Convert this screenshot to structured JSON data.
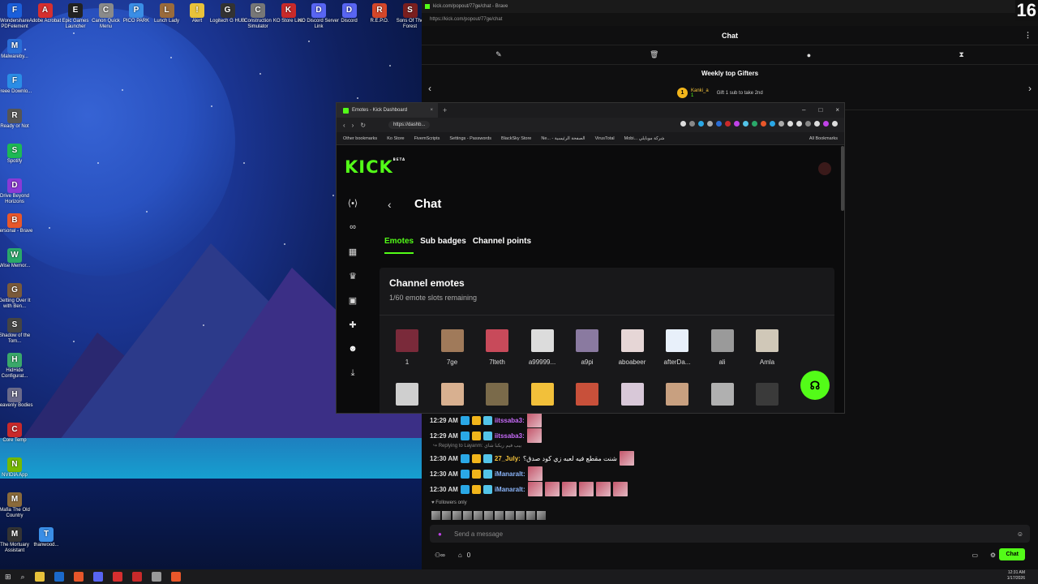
{
  "desktop": {
    "icons": [
      {
        "label": "Wondershare PDFelement",
        "color": "#1a5fdb",
        "glyph": "F"
      },
      {
        "label": "Adobe Acrobat",
        "color": "#d62f2f",
        "glyph": "A"
      },
      {
        "label": "Epic Games Launcher",
        "color": "#222",
        "glyph": "E"
      },
      {
        "label": "Canon Quick Menu",
        "color": "#8a8a8a",
        "glyph": "C"
      },
      {
        "label": "PICO PARK",
        "color": "#3a8ee6",
        "glyph": "P"
      },
      {
        "label": "Lunch Lady",
        "color": "#9a6b3b",
        "glyph": "L"
      },
      {
        "label": "Alert",
        "color": "#e8c23a",
        "glyph": "!"
      },
      {
        "label": "Logitech G HUB",
        "color": "#333",
        "glyph": "G"
      },
      {
        "label": "Construction Simulator",
        "color": "#777",
        "glyph": "C"
      },
      {
        "label": "KO Store Link",
        "color": "#c92a2a",
        "glyph": "K"
      },
      {
        "label": "KO Discord Server Link",
        "color": "#5865f2",
        "glyph": "D"
      },
      {
        "label": "Discord",
        "color": "#5865f2",
        "glyph": "D"
      },
      {
        "label": "R.E.P.O.",
        "color": "#d4472a",
        "glyph": "R"
      },
      {
        "label": "Sons Of The Forest",
        "color": "#7a1f1f",
        "glyph": "S"
      }
    ],
    "column": [
      {
        "label": "Malwareby...",
        "color": "#2a6dd6",
        "glyph": "M"
      },
      {
        "label": "Freee Downlo...",
        "color": "#2a8de6",
        "glyph": "F"
      },
      {
        "label": "Ready or Not",
        "color": "#555",
        "glyph": "R"
      },
      {
        "label": "Spotify",
        "color": "#1db954",
        "glyph": "S"
      },
      {
        "label": "Drive Beyond Horizons",
        "color": "#8a3ad6",
        "glyph": "D"
      },
      {
        "label": "Personal - Brave",
        "color": "#e8572a",
        "glyph": "B"
      },
      {
        "label": "Wise Memor...",
        "color": "#2aa86a",
        "glyph": "W"
      },
      {
        "label": "Getting Over It with Ben...",
        "color": "#7a5a3a",
        "glyph": "G"
      },
      {
        "label": "Shadow of the Tom...",
        "color": "#444",
        "glyph": "S"
      },
      {
        "label": "HidHide Configurat...",
        "color": "#3aa86a",
        "glyph": "H"
      },
      {
        "label": "Heavenly Bodies",
        "color": "#6a6a8a",
        "glyph": "H"
      },
      {
        "label": "Core Temp",
        "color": "#c92a2a",
        "glyph": "C"
      },
      {
        "label": "NVIDIA App",
        "color": "#76b900",
        "glyph": "N"
      },
      {
        "label": "Mafia The Old Country",
        "color": "#8a6a3a",
        "glyph": "M"
      },
      {
        "label": "The Mortuary Assistant",
        "color": "#333",
        "glyph": "M"
      }
    ],
    "extra_icon": {
      "label": "thanwood...",
      "color": "#3a8ee6",
      "glyph": "T"
    }
  },
  "popout": {
    "window_title": "kick.com/popout/77ge/chat - Brave",
    "url": "https://kick.com/popout/77ge/chat",
    "header_title": "Chat",
    "gifters_title": "Weekly top Gifters",
    "top_gifter_rank": "1",
    "top_gifter_name": "Kanki_a",
    "top_gifter_count": "1",
    "gift_hint": "Gift 1 sub to take 2nd",
    "messages": [
      {
        "time": "12:29 AM",
        "user": "iitssaba3:",
        "user_color": "#c86bfa",
        "text": ""
      },
      {
        "time": "12:29 AM",
        "user": "iitssaba3:",
        "user_color": "#c86bfa",
        "text": ""
      },
      {
        "time": "12:30 AM",
        "user": "27_July:",
        "user_color": "#f5c33b",
        "text": "شنت مقطع فيه لعبه زي كود صدق؟"
      },
      {
        "time": "12:30 AM",
        "user": "iManaralt:",
        "user_color": "#8ab4f8",
        "text": ""
      },
      {
        "time": "12:30 AM",
        "user": "iManaralt:",
        "user_color": "#8ab4f8",
        "text": ""
      }
    ],
    "reply_text": "Replying to Layanm: بيب فيم ريكبا شاي",
    "followers_label": "Followers only",
    "send_placeholder": "Send a message",
    "bottom_count": "0",
    "chat_button": "Chat"
  },
  "dashboard": {
    "tab_title": "Emotes - Kick Dashboard",
    "url_short": "https://dashb...",
    "bookmarks": [
      "Other bookmarks",
      "Ko Store",
      "FivemScripts",
      "Settings - Passwords",
      "BlackSky Store",
      "Ne... - الصفحة الرئيسية",
      "VirusTotal",
      "Mobi... شركة موبايلي"
    ],
    "all_bookmarks": "All Bookmarks",
    "logo": "KICK",
    "logo_beta": "BETA",
    "page_title": "Chat",
    "tabs": [
      "Emotes",
      "Sub badges",
      "Channel points"
    ],
    "card_title": "Channel emotes",
    "slots_text": "1/60 emote slots remaining",
    "emotes_row1": [
      {
        "name": "1",
        "color": "#7a2a3a"
      },
      {
        "name": "7ge",
        "color": "#a07a5a"
      },
      {
        "name": "7lteth",
        "color": "#c84a5a"
      },
      {
        "name": "a99999...",
        "color": "#dcdcdc"
      },
      {
        "name": "a9pi",
        "color": "#8a7aa0"
      },
      {
        "name": "aboabeer",
        "color": "#e6d6d6"
      },
      {
        "name": "afterDa...",
        "color": "#e8f0fa"
      },
      {
        "name": "ali",
        "color": "#9a9a9a"
      },
      {
        "name": "Amla",
        "color": "#d0c8b8"
      }
    ],
    "emotes_row2": [
      {
        "color": "#cfcfcf"
      },
      {
        "color": "#d8b090"
      },
      {
        "color": "#7a6a4a"
      },
      {
        "color": "#f2c03a"
      },
      {
        "color": "#c8503a"
      },
      {
        "color": "#d8c8d8"
      },
      {
        "color": "#c8a080"
      },
      {
        "color": "#b0b0b0"
      },
      {
        "color": "#3a3a3a"
      }
    ]
  },
  "taskbar": {
    "time": "12:31 AM",
    "date": "1/17/2026",
    "corner_text": "16"
  }
}
